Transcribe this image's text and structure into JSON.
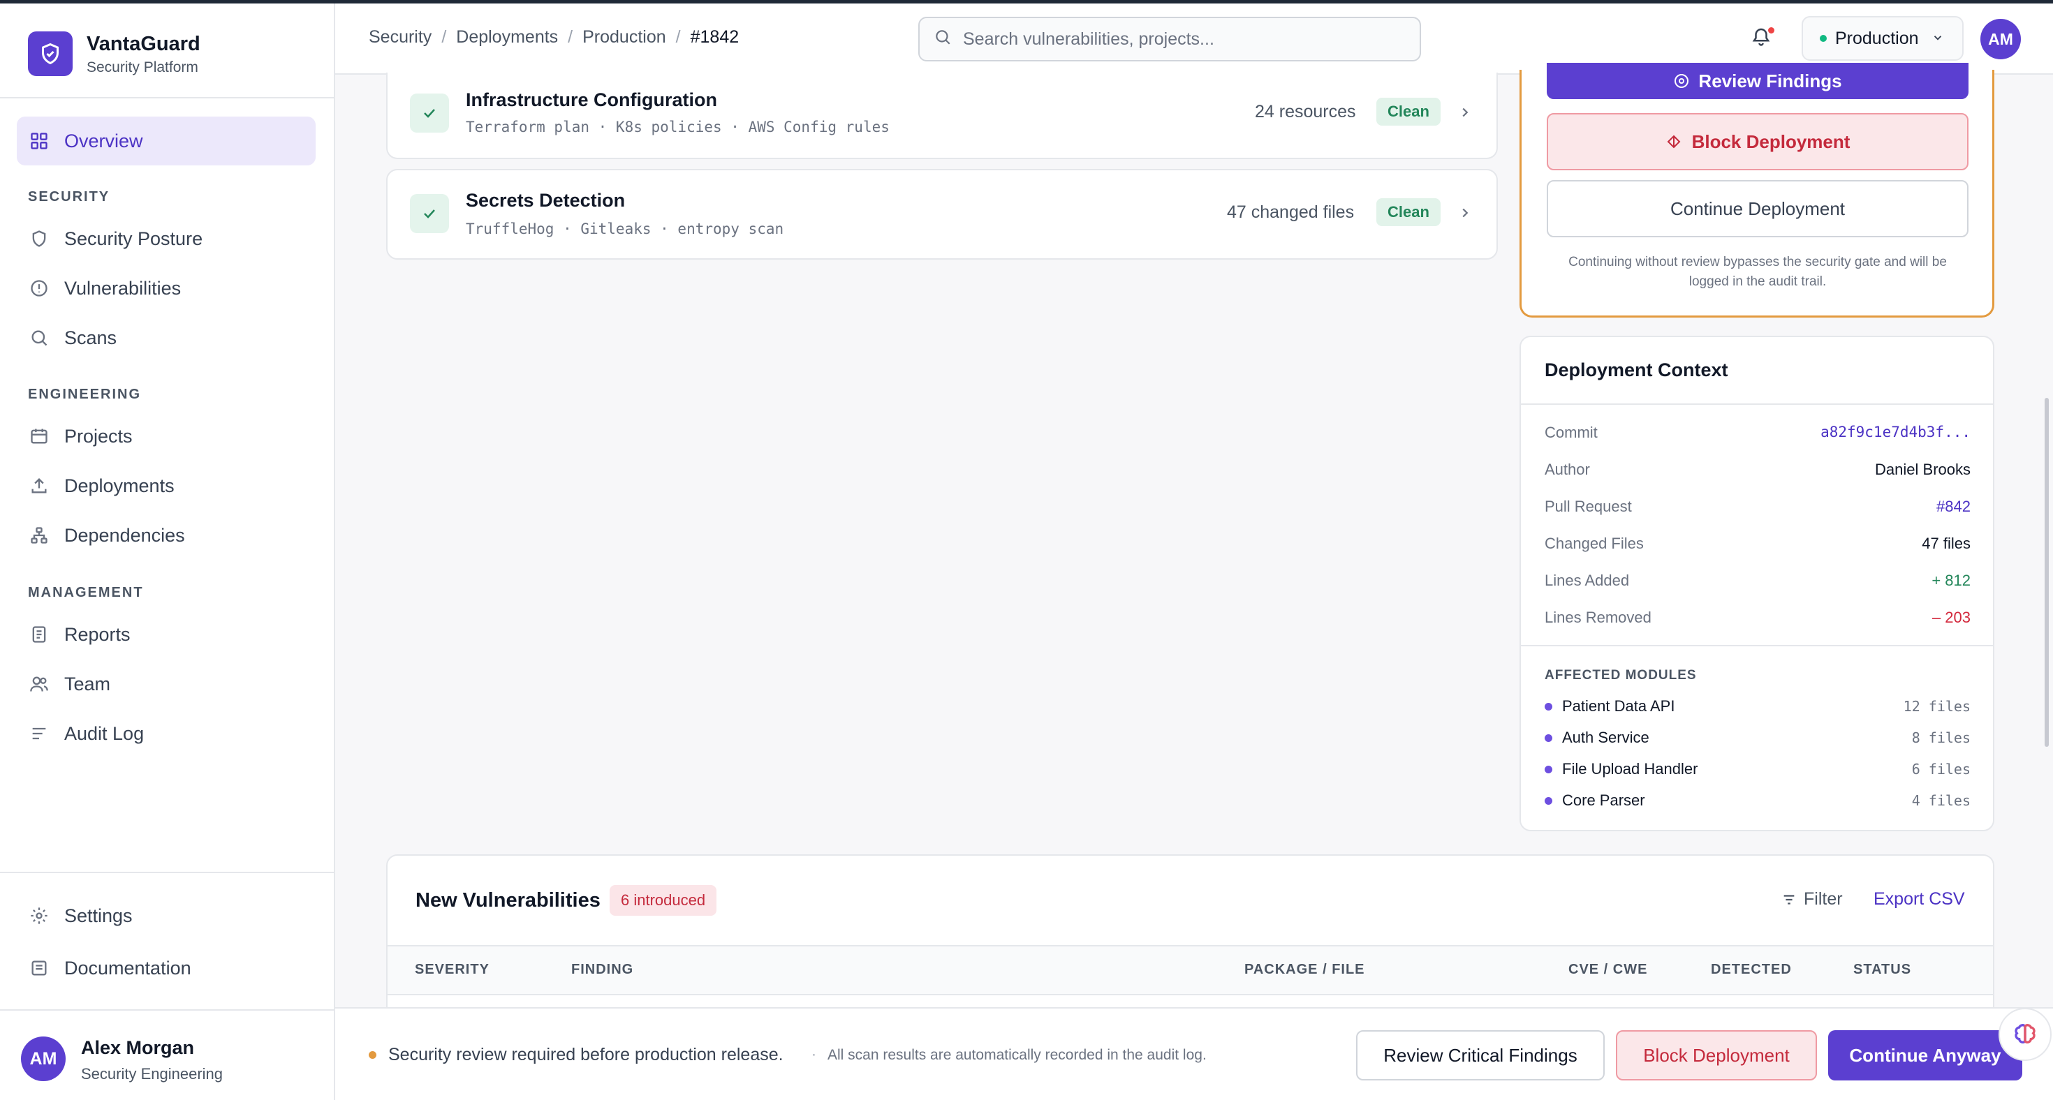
{
  "brand": {
    "name": "VantaGuard",
    "subtitle": "Security Platform"
  },
  "sidebar": {
    "overview": "Overview",
    "sections": [
      {
        "title": "SECURITY",
        "items": [
          "Security Posture",
          "Vulnerabilities",
          "Scans"
        ]
      },
      {
        "title": "ENGINEERING",
        "items": [
          "Projects",
          "Deployments",
          "Dependencies"
        ]
      },
      {
        "title": "MANAGEMENT",
        "items": [
          "Reports",
          "Team",
          "Audit Log"
        ]
      }
    ],
    "bottom": [
      "Settings",
      "Documentation"
    ],
    "user": {
      "initials": "AM",
      "name": "Alex Morgan",
      "role": "Security Engineering"
    }
  },
  "header": {
    "breadcrumbs": [
      "Security",
      "Deployments",
      "Production",
      "#1842"
    ],
    "search_placeholder": "Search vulnerabilities, projects...",
    "environment": "Production",
    "avatar_initials": "AM"
  },
  "scans": [
    {
      "title": "Infrastructure Configuration",
      "detail": "Terraform plan · K8s policies · AWS Config rules",
      "meta": "24 resources",
      "status": "Clean"
    },
    {
      "title": "Secrets Detection",
      "detail": "TruffleHog · Gitleaks · entropy scan",
      "meta": "47 changed files",
      "status": "Clean"
    }
  ],
  "gate": {
    "review_label": "Review Findings",
    "block_label": "Block Deployment",
    "continue_label": "Continue Deployment",
    "note": "Continuing without review bypasses the security gate and will be logged in the audit trail."
  },
  "context": {
    "title": "Deployment Context",
    "rows": [
      {
        "key": "Commit",
        "value": "a82f9c1e7d4b3f..."
      },
      {
        "key": "Author",
        "value": "Daniel Brooks"
      },
      {
        "key": "Pull Request",
        "value": "#842"
      },
      {
        "key": "Changed Files",
        "value": "47 files"
      },
      {
        "key": "Lines Added",
        "value": "+ 812"
      },
      {
        "key": "Lines Removed",
        "value": "– 203"
      }
    ],
    "modules_title": "AFFECTED MODULES",
    "modules": [
      {
        "name": "Patient Data API",
        "files": "12 files"
      },
      {
        "name": "Auth Service",
        "files": "8 files"
      },
      {
        "name": "File Upload Handler",
        "files": "6 files"
      },
      {
        "name": "Core Parser",
        "files": "4 files"
      }
    ]
  },
  "vulns": {
    "title": "New Vulnerabilities",
    "badge": "6 introduced",
    "filter_label": "Filter",
    "export_label": "Export CSV",
    "columns": [
      "SEVERITY",
      "FINDING",
      "PACKAGE / FILE",
      "CVE / CWE",
      "DETECTED",
      "STATUS"
    ]
  },
  "bottombar": {
    "message": "Security review required before production release.",
    "sep": "·",
    "note": "All scan results are automatically recorded in the audit log.",
    "review_label": "Review Critical Findings",
    "block_label": "Block Deployment",
    "continue_label": "Continue Anyway"
  },
  "colors": {
    "accent": "#5b3fd0",
    "warning_border": "#e39a3f",
    "danger": "#c0392b",
    "success": "#23865a"
  }
}
